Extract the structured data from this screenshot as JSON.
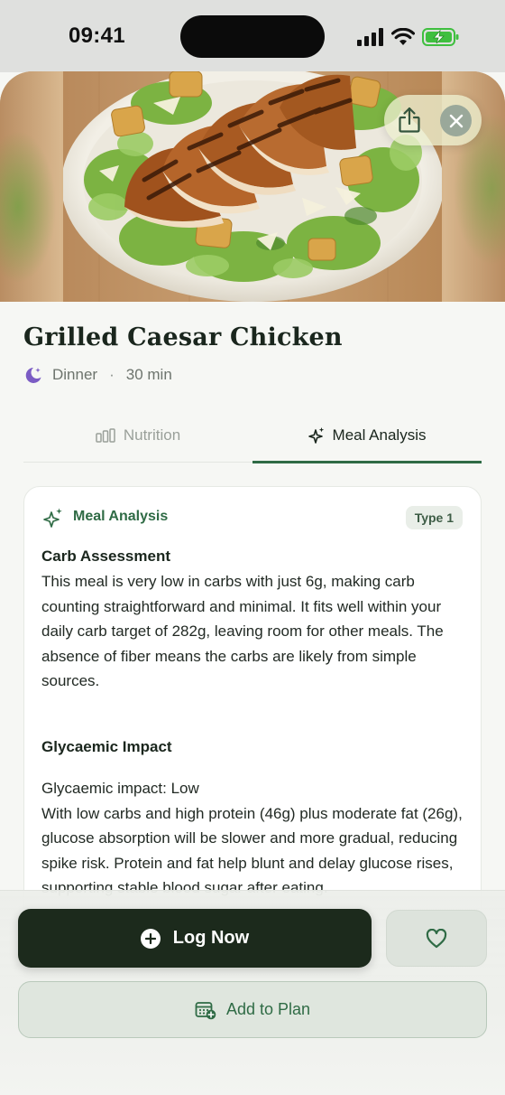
{
  "status_bar": {
    "time": "09:41",
    "icons": [
      "signal-icon",
      "wifi-icon",
      "battery-charging-icon"
    ],
    "battery_color": "#3fbf3f"
  },
  "hero": {
    "image": "grilled-caesar-chicken-photo",
    "actions": [
      "share-icon",
      "close-icon"
    ]
  },
  "meal": {
    "title": "Grilled Caesar Chicken",
    "meal_type": "Dinner",
    "separator": "·",
    "duration": "30 min",
    "meal_type_icon": "moon-stars-icon",
    "meal_type_icon_color": "#7b5cc4"
  },
  "tabs": [
    {
      "label": "Nutrition",
      "icon": "bar-chart-icon",
      "active": false
    },
    {
      "label": "Meal Analysis",
      "icon": "sparkle-icon",
      "active": true
    }
  ],
  "analysis": {
    "header": "Meal Analysis",
    "badge": "Type 1",
    "sections": [
      {
        "heading": "Carb Assessment",
        "body": "This meal is very low in carbs with just 6g, making carb counting straightforward and minimal. It fits well within your daily carb target of 282g, leaving room for other meals. The absence of fiber means the carbs are likely from simple sources."
      },
      {
        "heading": "Glycaemic Impact",
        "body": "Glycaemic impact: Low\nWith low carbs and high protein (46g) plus moderate fat (26g), glucose absorption will be slower and more gradual, reducing spike risk. Protein and fat help blunt and delay glucose rises, supporting stable blood sugar after eating."
      }
    ]
  },
  "actions": {
    "log_label": "Log Now",
    "favorite_icon": "heart-icon",
    "plan_label": "Add to Plan",
    "plan_icon": "calendar-add-icon"
  },
  "colors": {
    "accent": "#2f6b45",
    "primary_button": "#1c2a1c",
    "background": "#f6f7f4"
  }
}
